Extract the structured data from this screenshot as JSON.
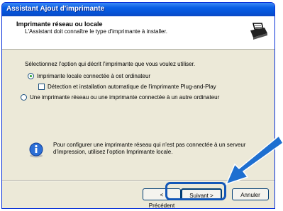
{
  "window": {
    "title": "Assistant Ajout d'imprimante"
  },
  "header": {
    "title": "Imprimante réseau ou locale",
    "subtitle": "L'Assistant doit connaître le type d'imprimante à installer."
  },
  "body": {
    "intro": "Sélectionnez l'option qui décrit l'imprimante que vous voulez utiliser.",
    "option_local": "Imprimante locale connectée à cet ordinateur",
    "option_local_selected": true,
    "checkbox_pnp": "Détection et installation automatique de l'imprimante Plug-and-Play",
    "checkbox_pnp_checked": false,
    "option_network": "Une imprimante réseau ou une imprimante connectée à un autre ordinateur",
    "info_text": "Pour configurer une imprimante réseau qui n'est pas connectée à un serveur d'impression, utilisez l'option Imprimante locale."
  },
  "buttons": {
    "back": "< Précédent",
    "next": "Suivant >",
    "cancel": "Annuler"
  },
  "colors": {
    "titlebar": "#0554d8",
    "highlight": "#1357b8",
    "arrow": "#1e6fd0"
  }
}
